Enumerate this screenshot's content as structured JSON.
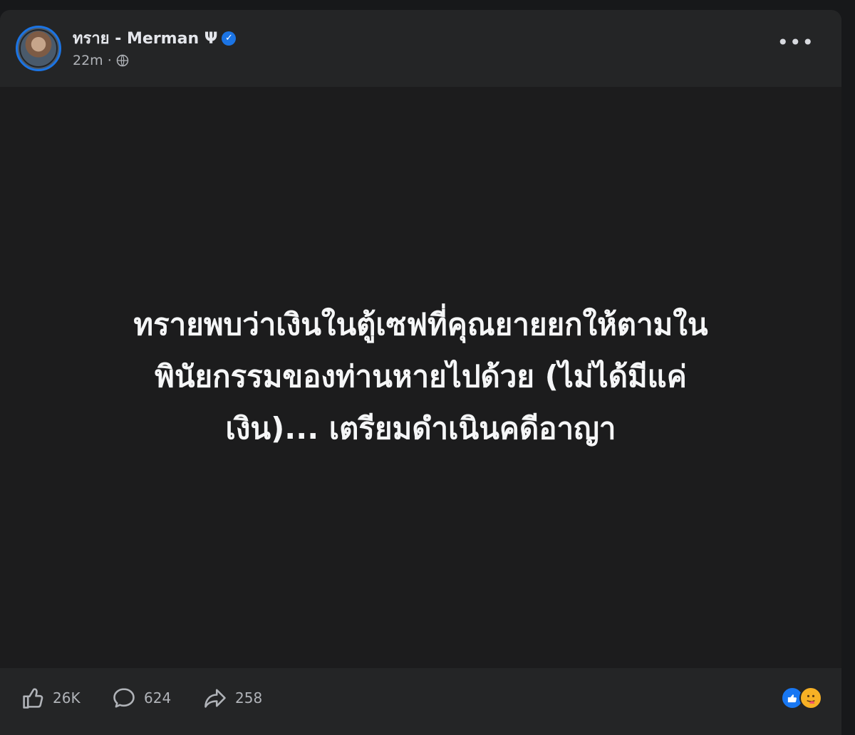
{
  "post": {
    "author_name": "ทราย - Merman Ψ",
    "timestamp": "22m",
    "separator": "·",
    "body_lines": [
      "ทรายพบว่าเงินในตู้เซฟที่คุณยายยกให้ตามใน",
      "พินัยกรรมของท่านหายไปด้วย (ไม่ได้มีแค่",
      "เงิน)... เตรียมดำเนินคดีอาญา"
    ],
    "more_label": "•••",
    "verified_badge": "✓"
  },
  "stats": {
    "likes": "26K",
    "comments": "624",
    "shares": "258"
  },
  "icons": {
    "avatar": "profile-photo",
    "verified": "verified-badge-icon",
    "privacy": "globe-icon",
    "more": "more-options-icon",
    "like": "thumbs-up-icon",
    "comment": "comment-bubble-icon",
    "share": "share-arrow-icon"
  },
  "colors": {
    "accent": "#1b74e4",
    "background": "#242526",
    "post_background": "#1c1c1d"
  }
}
